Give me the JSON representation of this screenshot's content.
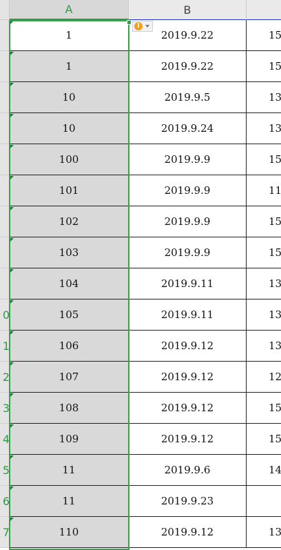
{
  "columns": {
    "a": "A",
    "b": "B"
  },
  "rows": [
    {
      "num": "",
      "a": "1",
      "b": "2019.9.22",
      "c": "15"
    },
    {
      "num": "",
      "a": "1",
      "b": "2019.9.22",
      "c": "15"
    },
    {
      "num": "",
      "a": "10",
      "b": "2019.9.5",
      "c": "13"
    },
    {
      "num": "",
      "a": "10",
      "b": "2019.9.24",
      "c": "13"
    },
    {
      "num": "",
      "a": "100",
      "b": "2019.9.9",
      "c": "15"
    },
    {
      "num": "",
      "a": "101",
      "b": "2019.9.9",
      "c": "11"
    },
    {
      "num": "",
      "a": "102",
      "b": "2019.9.9",
      "c": "15"
    },
    {
      "num": "",
      "a": "103",
      "b": "2019.9.9",
      "c": "15"
    },
    {
      "num": "",
      "a": "104",
      "b": "2019.9.11",
      "c": "13"
    },
    {
      "num": "0",
      "a": "105",
      "b": "2019.9.11",
      "c": "13"
    },
    {
      "num": "1",
      "a": "106",
      "b": "2019.9.12",
      "c": "13"
    },
    {
      "num": "2",
      "a": "107",
      "b": "2019.9.12",
      "c": "12"
    },
    {
      "num": "3",
      "a": "108",
      "b": "2019.9.12",
      "c": "15"
    },
    {
      "num": "4",
      "a": "109",
      "b": "2019.9.12",
      "c": "15"
    },
    {
      "num": "5",
      "a": "11",
      "b": "2019.9.6",
      "c": "14"
    },
    {
      "num": "6",
      "a": "11",
      "b": "2019.9.23",
      "c": ""
    },
    {
      "num": "7",
      "a": "110",
      "b": "2019.9.12",
      "c": "13"
    }
  ],
  "error_indicator": {
    "icon": "warning-icon",
    "symbol": "!"
  },
  "colors": {
    "selection": "#3aa04f",
    "header_bg": "#eaeaea",
    "selected_col_bg": "#d9d9d9",
    "warning": "#f0a020"
  }
}
